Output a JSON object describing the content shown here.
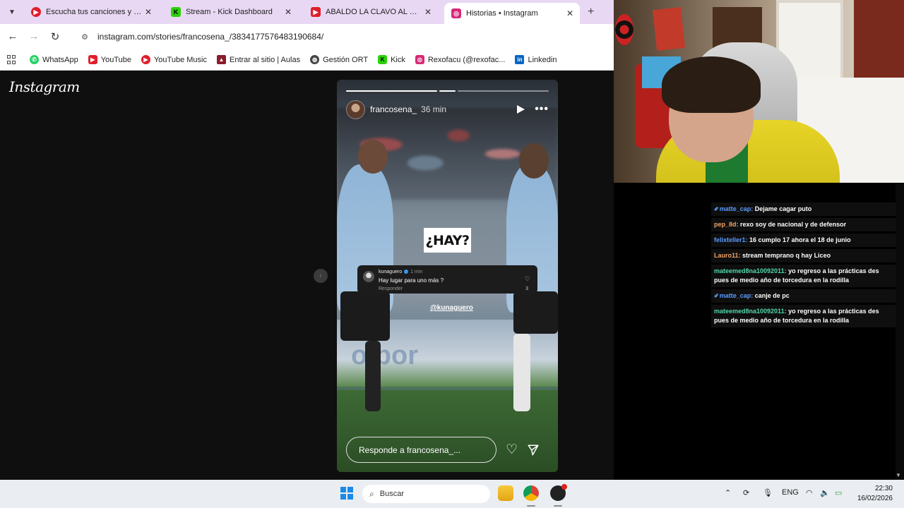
{
  "browser": {
    "tabs": [
      {
        "label": "Escucha tus canciones y álbume",
        "favicon_color": "#e01e2b",
        "active": false
      },
      {
        "label": "Stream - Kick Dashboard",
        "favicon_color": "#2cd10a",
        "active": false
      },
      {
        "label": "ABALDO LA CLAVÓ AL OTRO P",
        "favicon_color": "#e01e2b",
        "active": false
      },
      {
        "label": "Historias • Instagram",
        "favicon_color": "#d62976",
        "active": true
      }
    ],
    "url": "instagram.com/stories/francosena_/3834177576483190684/",
    "bookmarks": [
      {
        "label": "WhatsApp",
        "icon": "whatsapp-icon",
        "color": "#25d366"
      },
      {
        "label": "YouTube",
        "icon": "youtube-icon",
        "color": "#e01e2b"
      },
      {
        "label": "YouTube Music",
        "icon": "youtube-music-icon",
        "color": "#e01e2b"
      },
      {
        "label": "Entrar al sitio | Aulas",
        "icon": "graduation-cap-icon",
        "color": "#8a1c2b"
      },
      {
        "label": "Gestión ORT",
        "icon": "globe-icon",
        "color": "#444444"
      },
      {
        "label": "Kick",
        "icon": "kick-icon",
        "color": "#2cd10a"
      },
      {
        "label": "Rexofacu (@rexofac...",
        "icon": "instagram-icon",
        "color": "#d62976"
      },
      {
        "label": "Linkedin",
        "icon": "linkedin-icon",
        "color": "#0a66c2"
      }
    ]
  },
  "instagram": {
    "logo": "Instagram",
    "story": {
      "username": "francosena_",
      "time": "36 min",
      "sticker_text": "¿HAY?",
      "comment": {
        "user": "kunaguero",
        "time": "1 min",
        "text": "Hay lugar para uno más ?",
        "reply": "Responder",
        "likes": "3"
      },
      "mention": "@kunaguero",
      "banner_text": "o por",
      "reply_placeholder": "Responde a francosena_..."
    }
  },
  "chat": {
    "messages": [
      {
        "user": "matte_cap:",
        "text": "Dejame cagar puto",
        "color": "#5b9bff",
        "pinned": true
      },
      {
        "user": "pep_8d:",
        "text": "rexo soy de nacional y de defensor",
        "color": "#f2a365",
        "pinned": false
      },
      {
        "user": "felixteller1:",
        "text": "16 cumplo 17 ahora el 18 de junio",
        "color": "#5b9bff",
        "pinned": false
      },
      {
        "user": "Lauro11:",
        "text": "stream temprano q hay Liceo",
        "color": "#f2a365",
        "pinned": false
      },
      {
        "user": "mateemed8na10092011:",
        "text": "yo regreso a las prácticas des pues de medio año de torcedura en la rodilla",
        "color": "#53d8a8",
        "pinned": false
      },
      {
        "user": "matte_cap:",
        "text": "canje de pc",
        "color": "#5b9bff",
        "pinned": true
      },
      {
        "user": "mateemed8na10092011:",
        "text": "yo regreso a las prácticas des pues de medio año de torcedura en la rodilla",
        "color": "#53d8a8",
        "pinned": false
      }
    ]
  },
  "taskbar": {
    "search_placeholder": "Buscar",
    "language": "ENG",
    "time": "22:30",
    "date": "16/02/2026"
  }
}
